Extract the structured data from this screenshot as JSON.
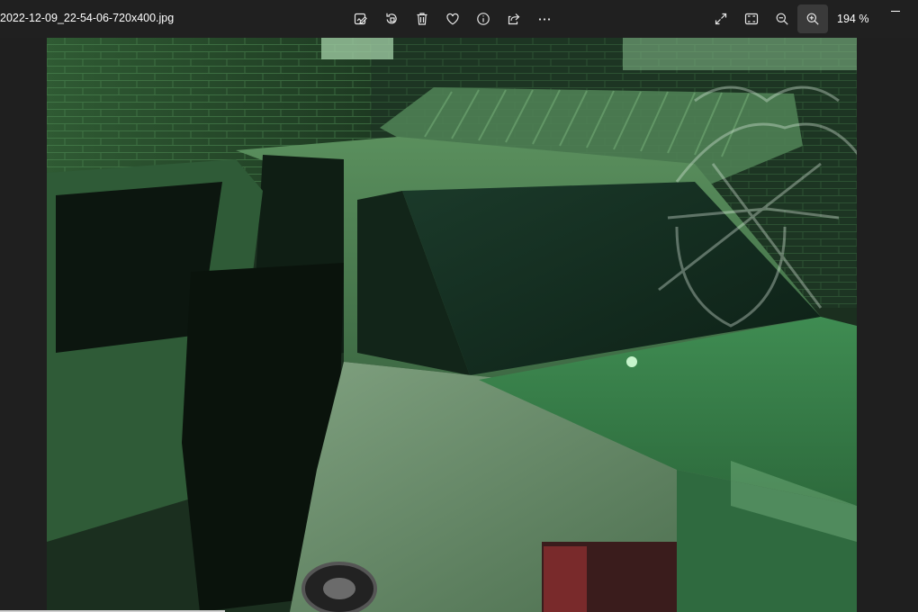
{
  "titlebar": {
    "filename": "2022-12-09_22-54-06-720x400.jpg"
  },
  "toolbar": {
    "buttons": [
      {
        "name": "edit-image-button",
        "icon": "edit-image-icon"
      },
      {
        "name": "rotate-button",
        "icon": "rotate-icon"
      },
      {
        "name": "delete-button",
        "icon": "trash-icon"
      },
      {
        "name": "favorite-button",
        "icon": "heart-icon"
      },
      {
        "name": "file-info-button",
        "icon": "info-icon"
      },
      {
        "name": "share-button",
        "icon": "share-icon"
      },
      {
        "name": "more-options-button",
        "icon": "more-icon"
      }
    ]
  },
  "view_tools": {
    "buttons": [
      {
        "name": "fullscreen-button",
        "icon": "expand-icon"
      },
      {
        "name": "fit-to-window-button",
        "icon": "fit-icon"
      },
      {
        "name": "zoom-out-button",
        "icon": "zoom-out-icon"
      },
      {
        "name": "zoom-in-button",
        "icon": "zoom-in-icon",
        "active": true
      }
    ],
    "zoom_level": "194 %"
  },
  "colors": {
    "background": "#202020",
    "active_button": "#3a3a3a",
    "text": "#ffffff"
  }
}
